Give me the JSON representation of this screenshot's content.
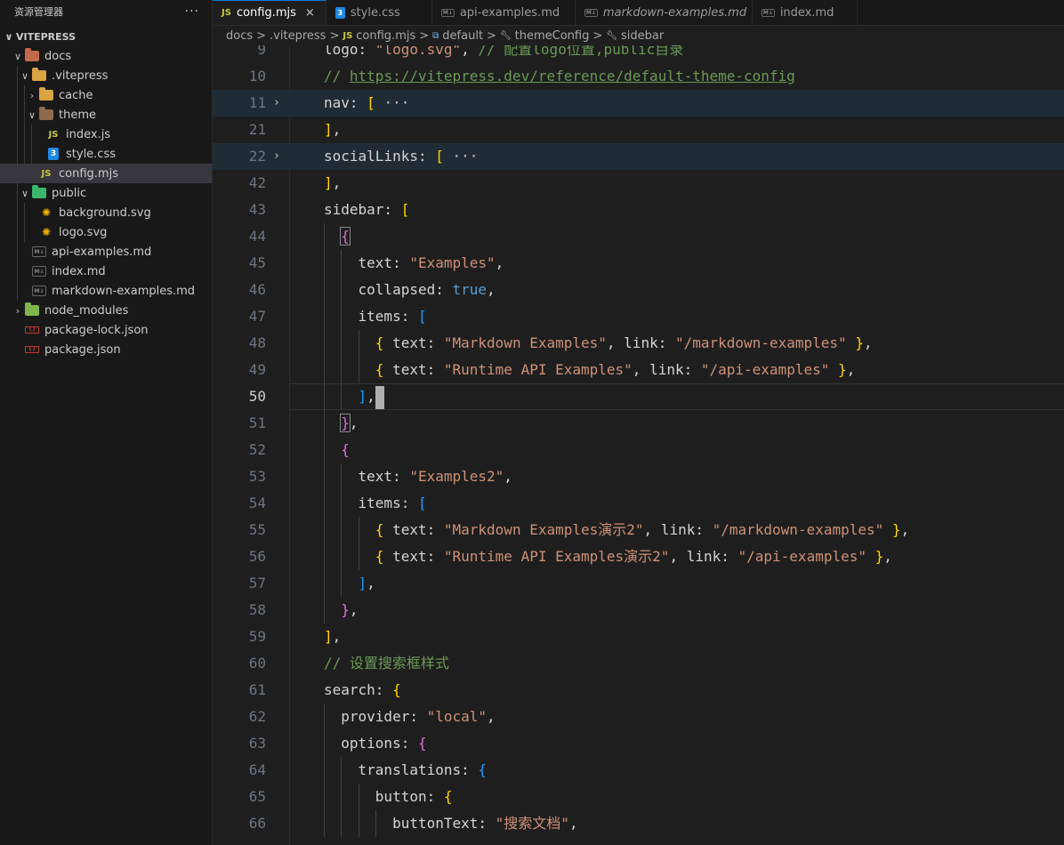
{
  "sidebar": {
    "title": "资源管理器",
    "more": "···",
    "section": "VITEPRESS",
    "tree": [
      {
        "label": "docs",
        "depth": 1,
        "chev": "∨",
        "icon": "folder-docs"
      },
      {
        "label": ".vitepress",
        "depth": 2,
        "chev": "∨",
        "icon": "folder-vitepress"
      },
      {
        "label": "cache",
        "depth": 3,
        "chev": "›",
        "icon": "folder-cache"
      },
      {
        "label": "theme",
        "depth": 3,
        "chev": "∨",
        "icon": "folder-theme"
      },
      {
        "label": "index.js",
        "depth": 4,
        "chev": "",
        "icon": "js"
      },
      {
        "label": "style.css",
        "depth": 4,
        "chev": "",
        "icon": "css"
      },
      {
        "label": "config.mjs",
        "depth": 3,
        "chev": "",
        "icon": "js"
      },
      {
        "label": "public",
        "depth": 2,
        "chev": "∨",
        "icon": "folder-public"
      },
      {
        "label": "background.svg",
        "depth": 3,
        "chev": "",
        "icon": "svg"
      },
      {
        "label": "logo.svg",
        "depth": 3,
        "chev": "",
        "icon": "svg"
      },
      {
        "label": "api-examples.md",
        "depth": 2,
        "chev": "",
        "icon": "md"
      },
      {
        "label": "index.md",
        "depth": 2,
        "chev": "",
        "icon": "md"
      },
      {
        "label": "markdown-examples.md",
        "depth": 2,
        "chev": "",
        "icon": "md"
      },
      {
        "label": "node_modules",
        "depth": 1,
        "chev": "›",
        "icon": "folder-node"
      },
      {
        "label": "package-lock.json",
        "depth": 1,
        "chev": "",
        "icon": "json"
      },
      {
        "label": "package.json",
        "depth": 1,
        "chev": "",
        "icon": "json"
      }
    ]
  },
  "tabs": [
    {
      "label": "config.mjs",
      "icon": "JS",
      "close": "×"
    },
    {
      "label": "style.css",
      "icon": "3"
    },
    {
      "label": "api-examples.md",
      "icon": "M↓"
    },
    {
      "label": "markdown-examples.md",
      "icon": "M↓"
    },
    {
      "label": "index.md",
      "icon": "M↓"
    }
  ],
  "breadcrumb": {
    "docs": "docs",
    "vitepress": ".vitepress",
    "file_icon": "JS",
    "file": "config.mjs",
    "default": "default",
    "themeConfig": "themeConfig",
    "sidebar": "sidebar",
    "sep": ">"
  },
  "code": [
    {
      "n": "9",
      "toks": [
        [
          "k",
          "logo: "
        ],
        [
          "s",
          "\"logo.svg\""
        ],
        [
          "k",
          ", "
        ],
        [
          "c",
          "// 配置logo位置,public目录"
        ]
      ]
    },
    {
      "n": "10",
      "toks": [
        [
          "c",
          "// "
        ],
        [
          "cu",
          "https://vitepress.dev/reference/default-theme-config"
        ]
      ]
    },
    {
      "n": "11",
      "toks": [
        [
          "k",
          "nav: "
        ],
        [
          "b1",
          "["
        ],
        [
          "el",
          " ···"
        ]
      ]
    },
    {
      "n": "21",
      "toks": [
        [
          "b1",
          "]"
        ],
        [
          "k",
          ","
        ]
      ]
    },
    {
      "n": "22",
      "toks": [
        [
          "k",
          "socialLinks: "
        ],
        [
          "b1",
          "["
        ],
        [
          "el",
          " ···"
        ]
      ]
    },
    {
      "n": "42",
      "toks": [
        [
          "b1",
          "]"
        ],
        [
          "k",
          ","
        ]
      ]
    },
    {
      "n": "43",
      "toks": [
        [
          "k",
          "sidebar: "
        ],
        [
          "b1",
          "["
        ]
      ]
    },
    {
      "n": "44",
      "toks": [
        [
          "k",
          "  "
        ],
        [
          "b2",
          "{"
        ]
      ]
    },
    {
      "n": "45",
      "toks": [
        [
          "k",
          "    text: "
        ],
        [
          "s",
          "\"Examples\""
        ],
        [
          "k",
          ","
        ]
      ]
    },
    {
      "n": "46",
      "toks": [
        [
          "k",
          "    collapsed: "
        ],
        [
          "kw",
          "true"
        ],
        [
          "k",
          ","
        ]
      ]
    },
    {
      "n": "47",
      "toks": [
        [
          "k",
          "    items: "
        ],
        [
          "b3",
          "["
        ]
      ]
    },
    {
      "n": "48",
      "toks": [
        [
          "k",
          "      "
        ],
        [
          "b1",
          "{"
        ],
        [
          "k",
          " text: "
        ],
        [
          "s",
          "\"Markdown Examples\""
        ],
        [
          "k",
          ", link: "
        ],
        [
          "s",
          "\"/markdown-examples\""
        ],
        [
          "k",
          " "
        ],
        [
          "b1",
          "}"
        ],
        [
          "k",
          ","
        ]
      ]
    },
    {
      "n": "49",
      "toks": [
        [
          "k",
          "      "
        ],
        [
          "b1",
          "{"
        ],
        [
          "k",
          " text: "
        ],
        [
          "s",
          "\"Runtime API Examples\""
        ],
        [
          "k",
          ", link: "
        ],
        [
          "s",
          "\"/api-examples\""
        ],
        [
          "k",
          " "
        ],
        [
          "b1",
          "}"
        ],
        [
          "k",
          ","
        ]
      ]
    },
    {
      "n": "50",
      "toks": [
        [
          "k",
          "    "
        ],
        [
          "b3",
          "]"
        ],
        [
          "k",
          ","
        ]
      ]
    },
    {
      "n": "51",
      "toks": [
        [
          "k",
          "  "
        ],
        [
          "b2",
          "}"
        ],
        [
          "k",
          ","
        ]
      ]
    },
    {
      "n": "52",
      "toks": [
        [
          "k",
          "  "
        ],
        [
          "b2",
          "{"
        ]
      ]
    },
    {
      "n": "53",
      "toks": [
        [
          "k",
          "    text: "
        ],
        [
          "s",
          "\"Examples2\""
        ],
        [
          "k",
          ","
        ]
      ]
    },
    {
      "n": "54",
      "toks": [
        [
          "k",
          "    items: "
        ],
        [
          "b3",
          "["
        ]
      ]
    },
    {
      "n": "55",
      "toks": [
        [
          "k",
          "      "
        ],
        [
          "b1",
          "{"
        ],
        [
          "k",
          " text: "
        ],
        [
          "s",
          "\"Markdown Examples演示2\""
        ],
        [
          "k",
          ", link: "
        ],
        [
          "s",
          "\"/markdown-examples\""
        ],
        [
          "k",
          " "
        ],
        [
          "b1",
          "}"
        ],
        [
          "k",
          ","
        ]
      ]
    },
    {
      "n": "56",
      "toks": [
        [
          "k",
          "      "
        ],
        [
          "b1",
          "{"
        ],
        [
          "k",
          " text: "
        ],
        [
          "s",
          "\"Runtime API Examples演示2\""
        ],
        [
          "k",
          ", link: "
        ],
        [
          "s",
          "\"/api-examples\""
        ],
        [
          "k",
          " "
        ],
        [
          "b1",
          "}"
        ],
        [
          "k",
          ","
        ]
      ]
    },
    {
      "n": "57",
      "toks": [
        [
          "k",
          "    "
        ],
        [
          "b3",
          "]"
        ],
        [
          "k",
          ","
        ]
      ]
    },
    {
      "n": "58",
      "toks": [
        [
          "k",
          "  "
        ],
        [
          "b2",
          "}"
        ],
        [
          "k",
          ","
        ]
      ]
    },
    {
      "n": "59",
      "toks": [
        [
          "b1",
          "]"
        ],
        [
          "k",
          ","
        ]
      ]
    },
    {
      "n": "60",
      "toks": [
        [
          "c",
          "// 设置搜索框样式"
        ]
      ]
    },
    {
      "n": "61",
      "toks": [
        [
          "k",
          "search: "
        ],
        [
          "b1",
          "{"
        ]
      ]
    },
    {
      "n": "62",
      "toks": [
        [
          "k",
          "  provider: "
        ],
        [
          "s",
          "\"local\""
        ],
        [
          "k",
          ","
        ]
      ]
    },
    {
      "n": "63",
      "toks": [
        [
          "k",
          "  options: "
        ],
        [
          "b2",
          "{"
        ]
      ]
    },
    {
      "n": "64",
      "toks": [
        [
          "k",
          "    translations: "
        ],
        [
          "b3",
          "{"
        ]
      ]
    },
    {
      "n": "65",
      "toks": [
        [
          "k",
          "      button: "
        ],
        [
          "b1",
          "{"
        ]
      ]
    },
    {
      "n": "66",
      "toks": [
        [
          "k",
          "        buttonText: "
        ],
        [
          "s",
          "\"搜索文档\""
        ],
        [
          "k",
          ","
        ]
      ]
    }
  ]
}
